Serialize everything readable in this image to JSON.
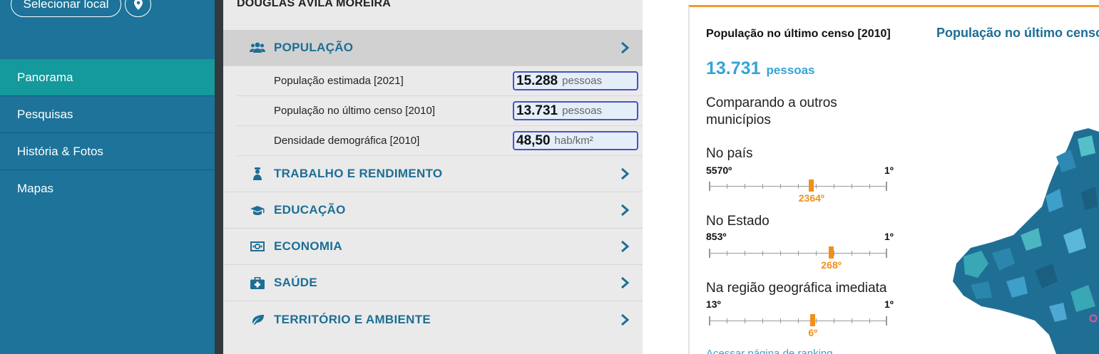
{
  "sidebar": {
    "select_location_label": "Selecionar local",
    "location_icon": "map-pin-icon",
    "nav": [
      {
        "label": "Panorama",
        "active": true
      },
      {
        "label": "Pesquisas",
        "active": false
      },
      {
        "label": "História & Fotos",
        "active": false
      },
      {
        "label": "Mapas",
        "active": false
      }
    ]
  },
  "middle": {
    "city_name": "DOUGLAS ÁVILA MOREIRA",
    "sections": [
      {
        "label": "POPULAÇÃO",
        "icon": "people-icon",
        "open": true
      },
      {
        "label": "TRABALHO E RENDIMENTO",
        "icon": "worker-icon",
        "open": false
      },
      {
        "label": "EDUCAÇÃO",
        "icon": "graduation-cap-icon",
        "open": false
      },
      {
        "label": "ECONOMIA",
        "icon": "money-icon",
        "open": false
      },
      {
        "label": "SAÚDE",
        "icon": "medical-kit-icon",
        "open": false
      },
      {
        "label": "TERRITÓRIO E AMBIENTE",
        "icon": "leaf-icon",
        "open": false
      }
    ],
    "population_rows": [
      {
        "label": "População estimada [2021]",
        "value": "15.288",
        "unit": "pessoas"
      },
      {
        "label": "População no último censo [2010]",
        "value": "13.731",
        "unit": "pessoas"
      },
      {
        "label": "Densidade demográfica [2010]",
        "value": "48,50",
        "unit": "hab/km²"
      }
    ]
  },
  "right": {
    "title": "População no último censo [2010]",
    "value": "13.731",
    "value_unit": "pessoas",
    "comparing_label": "Comparando a outros municípios",
    "rankings": [
      {
        "label": "No país",
        "min": "5570º",
        "max": "1º",
        "position": "2364º",
        "total": 5570,
        "rank": 2364
      },
      {
        "label": "No Estado",
        "min": "853º",
        "max": "1º",
        "position": "268º",
        "total": 853,
        "rank": 268
      },
      {
        "label": "Na região geográfica imediata",
        "min": "13º",
        "max": "1º",
        "position": "6º",
        "total": 13,
        "rank": 6
      }
    ],
    "ranking_link": "Acessar página de ranking",
    "map_title": "População no último censo",
    "accent_color": "#f0901a",
    "brand_color": "#1d7399"
  }
}
